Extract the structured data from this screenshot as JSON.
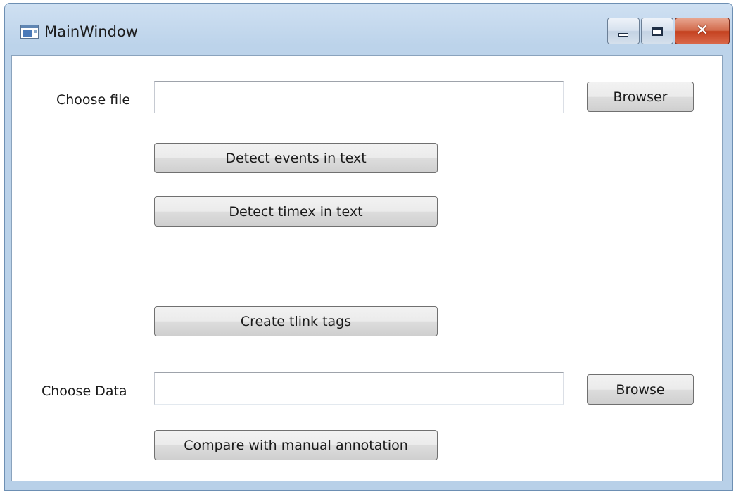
{
  "window": {
    "title": "MainWindow",
    "close_glyph": "✕"
  },
  "form": {
    "choose_file_label": "Choose file",
    "file_path_value": "",
    "browser_button": "Browser",
    "detect_events_button": "Detect events in text",
    "detect_timex_button": "Detect timex in text",
    "create_tlink_button": "Create tlink tags",
    "choose_data_label": "Choose Data",
    "data_path_value": "",
    "browse_button": "Browse",
    "compare_button": "Compare with manual annotation"
  },
  "icons": {
    "app": "app-window-icon",
    "minimize": "minimize-icon",
    "maximize": "maximize-icon",
    "close": "close-icon"
  }
}
